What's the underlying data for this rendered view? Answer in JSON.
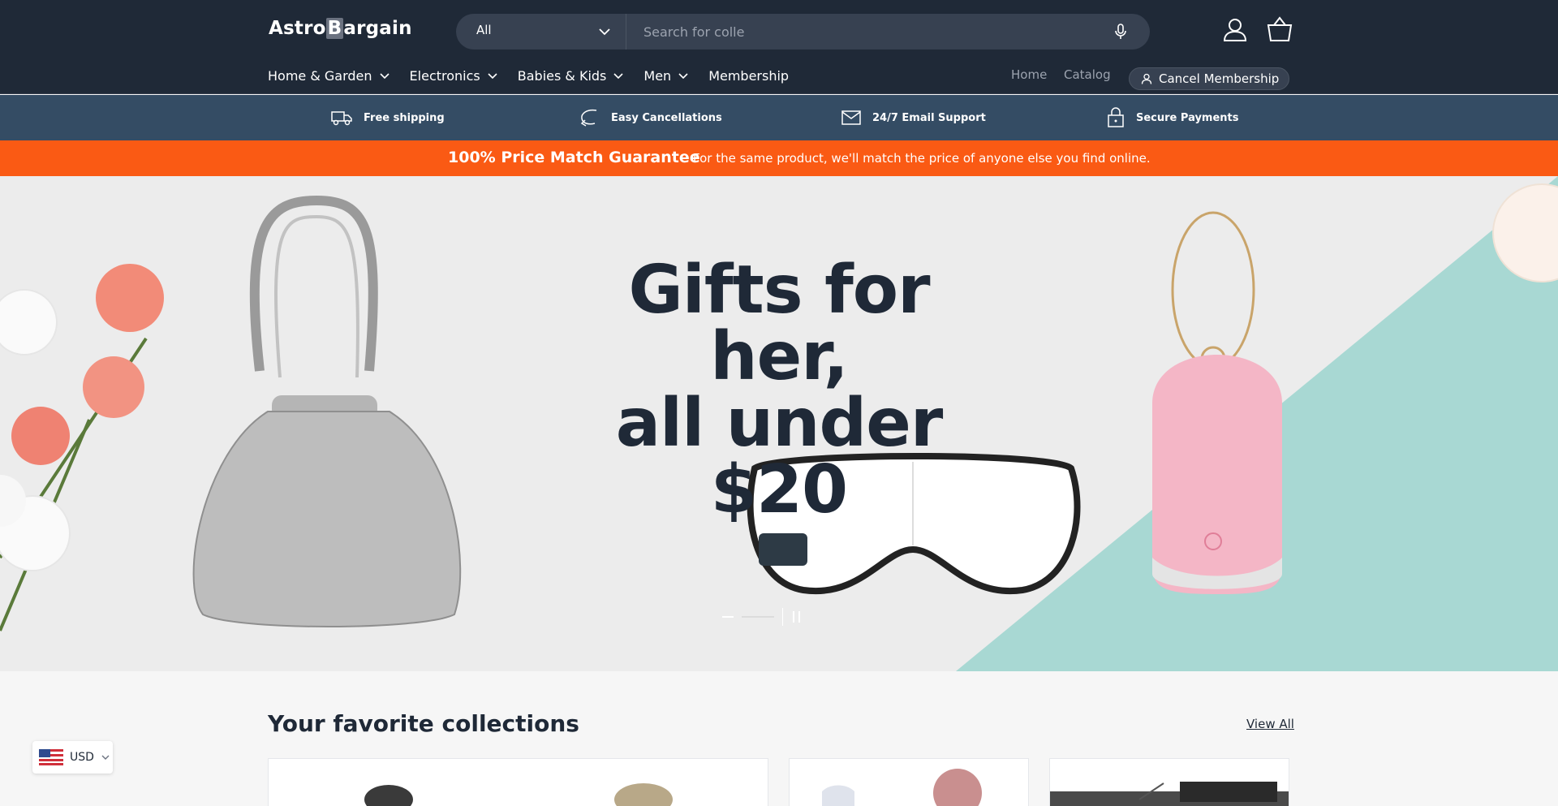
{
  "brand": {
    "logo_text_a": "Astro",
    "logo_text_b": "B",
    "logo_text_c": "argain"
  },
  "search": {
    "category": "All",
    "placeholder": "Search for colle"
  },
  "nav": {
    "items": [
      {
        "label": "Home & Garden"
      },
      {
        "label": "Electronics"
      },
      {
        "label": "Babies & Kids"
      },
      {
        "label": "Men"
      },
      {
        "label": "Membership"
      }
    ],
    "home": "Home",
    "catalog": "Catalog",
    "cancel_membership": "Cancel Membership"
  },
  "features": [
    {
      "label": "Free shipping",
      "icon": "truck-icon"
    },
    {
      "label": "Easy Cancellations",
      "icon": "return-arrow-icon"
    },
    {
      "label": "24/7 Email Support",
      "icon": "envelope-icon"
    },
    {
      "label": "Secure Payments",
      "icon": "lock-icon"
    }
  ],
  "banner": {
    "title": "100% Price Match Guarantee",
    "text": "For the same product, we'll match the price of anyone else you find online."
  },
  "hero": {
    "line1": "Gifts for her,",
    "line2": "all under $20"
  },
  "collections": {
    "title": "Your favorite collections",
    "view_all": "View All"
  },
  "currency": {
    "code": "USD"
  },
  "colors": {
    "header_bg": "#1f2937",
    "features_bg": "#344c64",
    "banner_bg": "#fa5a14",
    "teal": "#a8d8d3"
  }
}
